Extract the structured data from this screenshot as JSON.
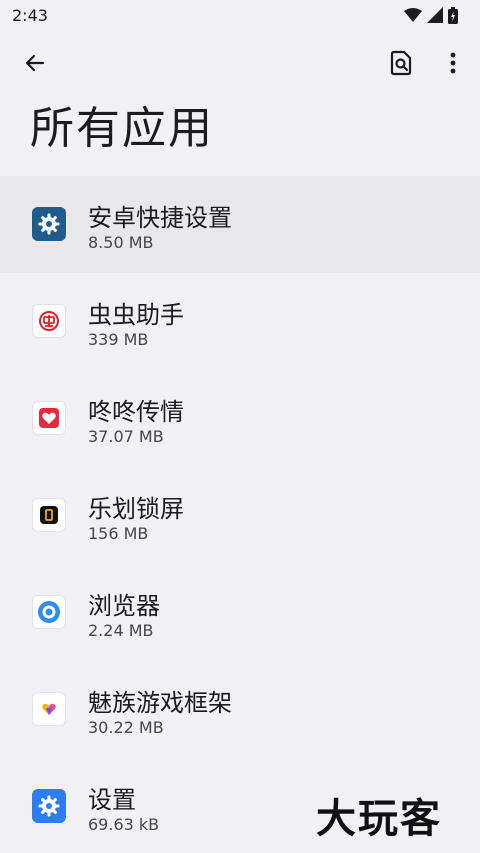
{
  "status_bar": {
    "time": "2:43",
    "icons": [
      "wifi-icon",
      "signal-icon",
      "battery-icon"
    ]
  },
  "app_bar": {
    "back_icon": "arrow-back-icon",
    "search_icon": "search-document-icon",
    "more_icon": "more-vert-icon"
  },
  "page": {
    "title": "所有应用"
  },
  "apps": [
    {
      "name": "安卓快捷设置",
      "size": "8.50 MB",
      "icon": "gear-icon",
      "color": "#1f5c8c"
    },
    {
      "name": "虫虫助手",
      "size": "339 MB",
      "icon": "chongchong-logo-icon",
      "color": "#e0202e"
    },
    {
      "name": "咚咚传情",
      "size": "37.07 MB",
      "icon": "heart-icon",
      "color": "#e8283c"
    },
    {
      "name": "乐划锁屏",
      "size": "156 MB",
      "icon": "lock-screen-icon",
      "color": "#111111"
    },
    {
      "name": "浏览器",
      "size": "2.24 MB",
      "icon": "browser-icon",
      "color": "#2c8cf0"
    },
    {
      "name": "魅族游戏框架",
      "size": "30.22 MB",
      "icon": "game-framework-icon",
      "color": "#f0508c"
    },
    {
      "name": "设置",
      "size": "69.63 kB",
      "icon": "settings-icon",
      "color": "#2f7df6"
    }
  ],
  "watermark": {
    "text": "大玩客"
  }
}
